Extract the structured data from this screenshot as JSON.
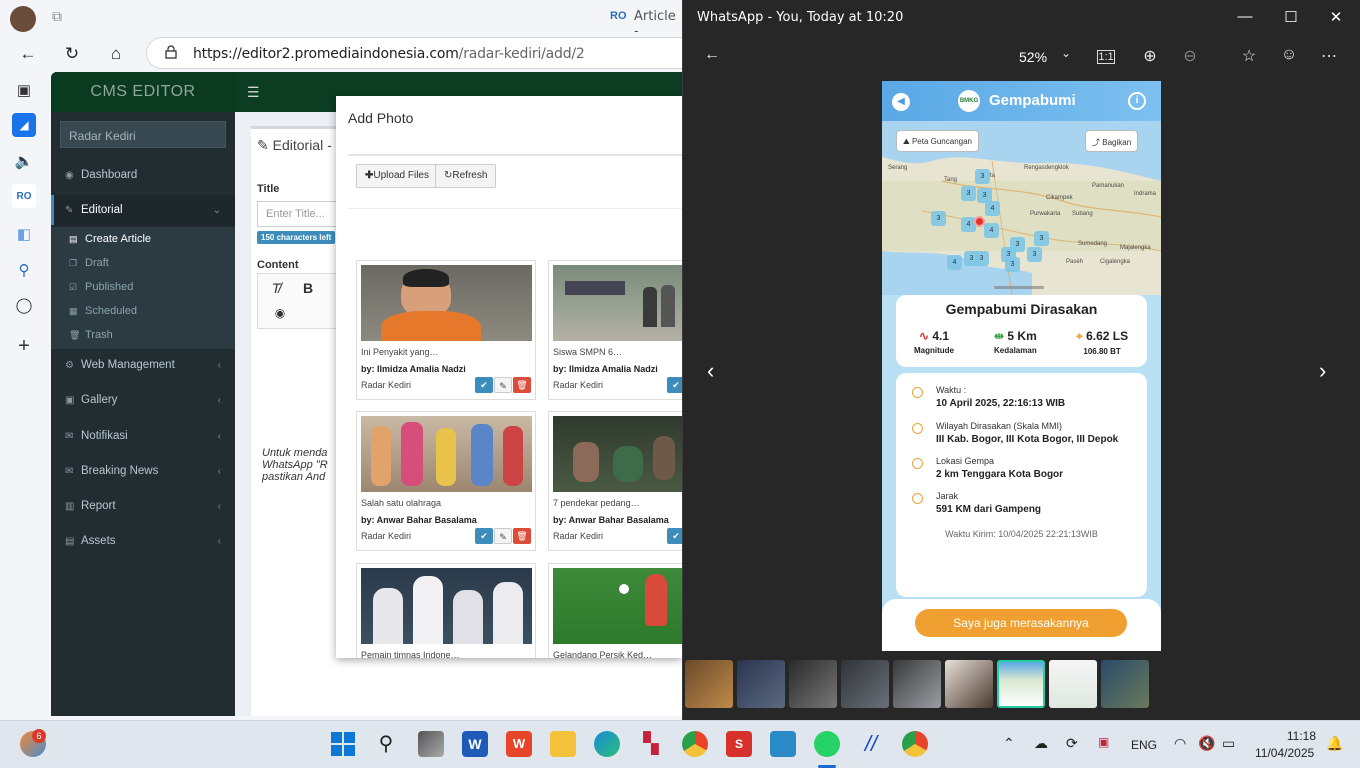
{
  "browser": {
    "tab_title": "Article -",
    "url_host": "https://editor2.promediaindonesia.com",
    "url_path": "/radar-kediri/add/2"
  },
  "cms": {
    "logo": "CMS EDITOR",
    "search_value": "Radar Kediri",
    "menu": {
      "dashboard": "Dashboard",
      "editorial": "Editorial",
      "create_article": "Create Article",
      "draft": "Draft",
      "published": "Published",
      "scheduled": "Scheduled",
      "trash": "Trash",
      "web_management": "Web Management",
      "gallery": "Gallery",
      "notifikasi": "Notifikasi",
      "breaking_news": "Breaking News",
      "report": "Report",
      "assets": "Assets"
    },
    "editor": {
      "title": "Editorial - (",
      "title_label": "Title",
      "title_placeholder": "Enter Title...",
      "char_badge": "150 characters left",
      "content_label": "Content",
      "content_line1": "Untuk menda",
      "content_line2": "WhatsApp \"R",
      "content_line3": "pastikan And"
    }
  },
  "modal": {
    "title": "Add Photo",
    "upload_label": "Upload Files",
    "refresh_label": "Refresh",
    "cards": [
      {
        "caption": "Ini Penyakit yang…",
        "by": "by: Ilmidza Amalia Nadzi",
        "source": "Radar Kediri"
      },
      {
        "caption": "Siswa SMPN 6…",
        "by": "by: Ilmidza Amalia Nadzi",
        "source": "Radar Kediri"
      },
      {
        "caption": "Salah satu olahraga",
        "by": "by: Anwar Bahar Basalama",
        "source": "Radar Kediri"
      },
      {
        "caption": "7 pendekar pedang…",
        "by": "by: Anwar Bahar Basalama",
        "source": "Radar Kediri"
      },
      {
        "caption": "Pemain timnas Indone…",
        "by": "",
        "source": ""
      },
      {
        "caption": "Gelandang Persik Ked…",
        "by": "",
        "source": ""
      }
    ]
  },
  "viewer": {
    "window_title": "WhatsApp - You, Today at 10:20",
    "zoom": "52%"
  },
  "quake": {
    "app_title": "Gempabumi",
    "bmkg": "BMKG",
    "btn_map": "Peta Guncangan",
    "btn_share": "Bagikan",
    "felt_title": "Gempabumi Dirasakan",
    "magnitude": "4.1",
    "magnitude_label": "Magnitude",
    "depth": "5 Km",
    "depth_label": "Kedalaman",
    "lat": "6.62 LS",
    "lon": "106.80 BT",
    "time_label": "Waktu :",
    "time_value": "10 April 2025, 22:16:13 WIB",
    "region_label": "Wilayah Dirasakan (Skala MMI)",
    "region_value": "III Kab. Bogor, III Kota Bogor, III Depok",
    "location_label": "Lokasi Gempa",
    "location_value": "2 km Tenggara Kota Bogor",
    "distance_label": "Jarak",
    "distance_value": "591 KM dari Gampeng",
    "sent": "Waktu Kirim: 10/04/2025 22:21:13WIB",
    "felt_button": "Saya juga merasakannya",
    "map_labels": [
      "Serang",
      "Tang",
      "rta",
      "Rengasdengklok",
      "Pamanukan",
      "Indrama",
      "Cikampek",
      "Purwakarta",
      "Subang",
      "Sumedang",
      "Majalengka",
      "Pasèh",
      "Cigalengka"
    ]
  },
  "taskbar": {
    "notif_count": "6",
    "lang": "ENG",
    "time": "11:18",
    "date": "11/04/2025"
  }
}
